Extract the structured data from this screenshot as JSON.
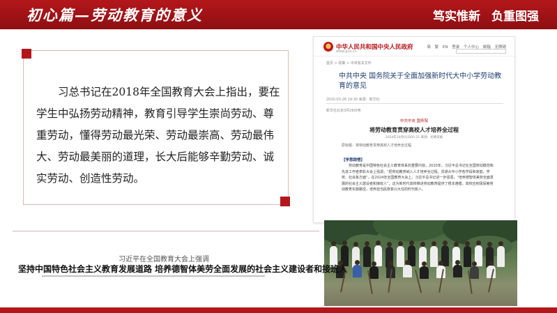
{
  "header": {
    "title": "初心篇—劳动教育的意义",
    "slogan_1": "笃实惟新",
    "slogan_2": "负重图强"
  },
  "quote": {
    "text": "习总书记在2018年全国教育大会上指出，要在学生中弘扬劳动精神，教育引导学生崇尚劳动、尊重劳动，懂得劳动最光荣、劳动最崇高、劳动最伟大、劳动最美丽的道理，长大后能够辛勤劳动、诚实劳动、创造性劳动。"
  },
  "captions": {
    "small": "习近平在全国教育大会上强调",
    "main": "坚持中国特色社会主义教育发展道路 培养德智体美劳全面发展的社会主义建设者和接班人"
  },
  "gov_page": {
    "site_name": "中华人民共和国中央人民政府",
    "site_url": "www.gov.cn",
    "nav": [
      "简",
      "繁",
      "EN",
      "登录",
      "个人中心",
      "邮箱",
      "无障碍"
    ],
    "breadcrumb": "首页 > 政策 > 中央有关文件",
    "article_title": "中共中央 国务院关于全面加强新时代大中小学劳动教育的意见",
    "meta": "2020-03-26 19:30  来源：新华社",
    "source_line": "新华社北京3月26日电",
    "paper_head": "中共中央  国务院",
    "paper_title": "将劳动教育贯穿高校人才培养全过程",
    "paper_meta": "2024年10月01日05:21  来源：光明日报",
    "paper_subline": "原标题：将劳动教育贯穿高校人才培养全过程",
    "tag": "【学思践悟】",
    "paragraph": "劳动教育是中国特色社会主义教育体系的重要内容。2020年，习近平总书记在全国劳动模范和先进工作者表彰大会上强调，“把劳动教育纳入人才培养全过程，贯通大中小学各学段和家庭、学校、社会各方面”。在2024年全国教育大会上，习近平总书记进一步强调，“培养德智体美劳全面发展的社会主义建设者和接班人”，这为新时代高校推进劳动教育提供了根本遵循。高校应积极探索劳动教育实施路径，培养担当民族复兴大任的时代新人。"
  },
  "photo": {
    "subject": "students-with-shovels-group-photo"
  },
  "colors": {
    "brand_red": "#b3171b",
    "white": "#ffffff",
    "gov_blue": "#1b3c6e"
  }
}
